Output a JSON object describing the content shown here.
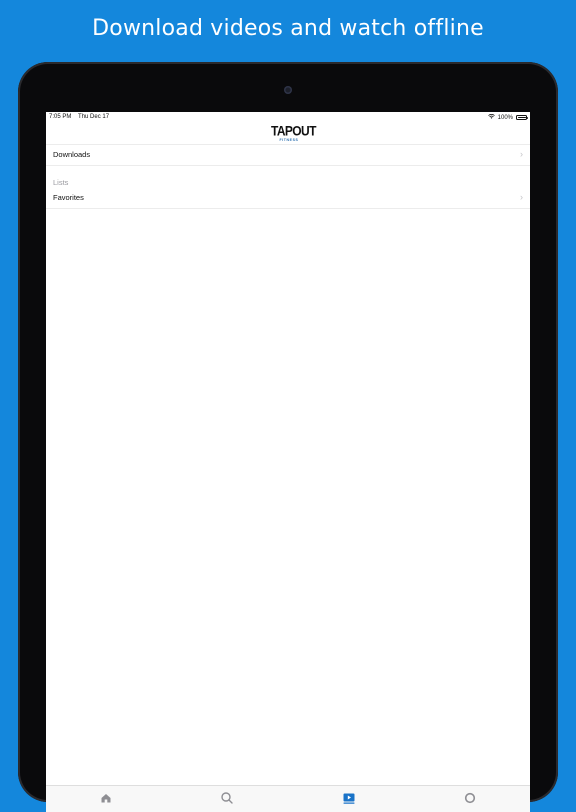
{
  "banner": {
    "headline": "Download videos and watch offline"
  },
  "status_bar": {
    "time": "7:05 PM",
    "date": "Thu Dec 17",
    "battery": "100%",
    "battery_level": 1.0
  },
  "header": {
    "logo_main": "TAPOUT",
    "logo_sub": "FITNESS"
  },
  "list": {
    "downloads_label": "Downloads",
    "section_title": "Lists",
    "favorites_label": "Favorites"
  },
  "tab_bar": {
    "tabs": [
      {
        "icon": "home-icon",
        "active": false
      },
      {
        "icon": "search-icon",
        "active": false
      },
      {
        "icon": "video-library-icon",
        "active": true
      },
      {
        "icon": "profile-icon",
        "active": false
      }
    ],
    "active_color": "#1a73c8",
    "inactive_color": "#8e8e93"
  },
  "colors": {
    "background": "#1487dc",
    "accent": "#1a73c8"
  }
}
